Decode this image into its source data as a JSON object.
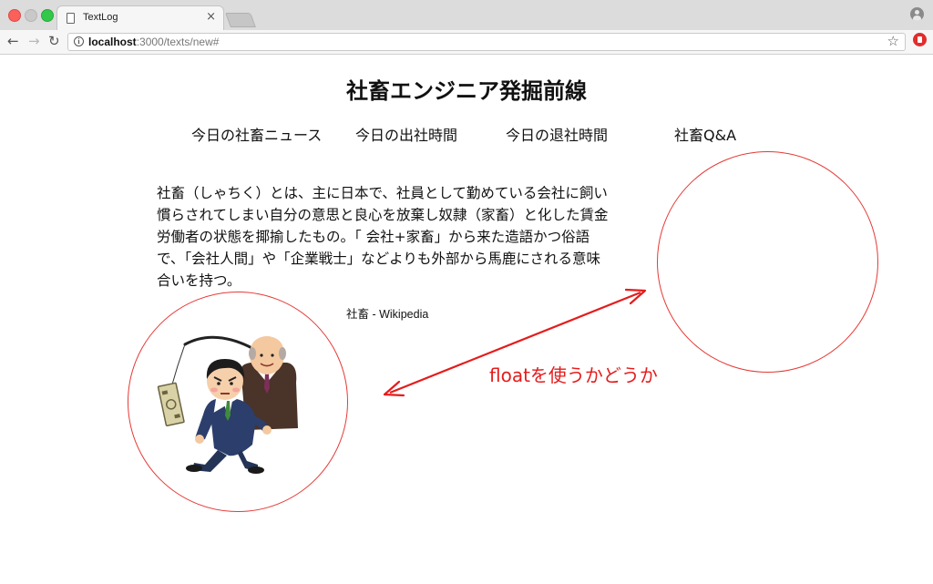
{
  "browser": {
    "tab_title": "TextLog",
    "tab_close": "×",
    "url_host": "localhost",
    "url_path": ":3000/texts/new#"
  },
  "page": {
    "title": "社畜エンジニア発掘前線",
    "nav": [
      "今日の社畜ニュース",
      "今日の出社時間",
      "今日の退社時間",
      "社畜Q&A"
    ],
    "description": "社畜（しゃちく）とは、主に日本で、社員として勤めている会社に飼い慣らされてしまい自分の意思と良心を放棄し奴隷（家畜）と化した賃金労働者の状態を揶揄したもの。「 会社+家畜」から来た造語かつ俗語で、「会社人間」や「企業戦士」などよりも外部から馬鹿にされる意味合いを持つ。",
    "citation": "社畜 - Wikipedia"
  },
  "annotation": {
    "text": "floatを使うかどうか",
    "color": "#e51c1c"
  }
}
